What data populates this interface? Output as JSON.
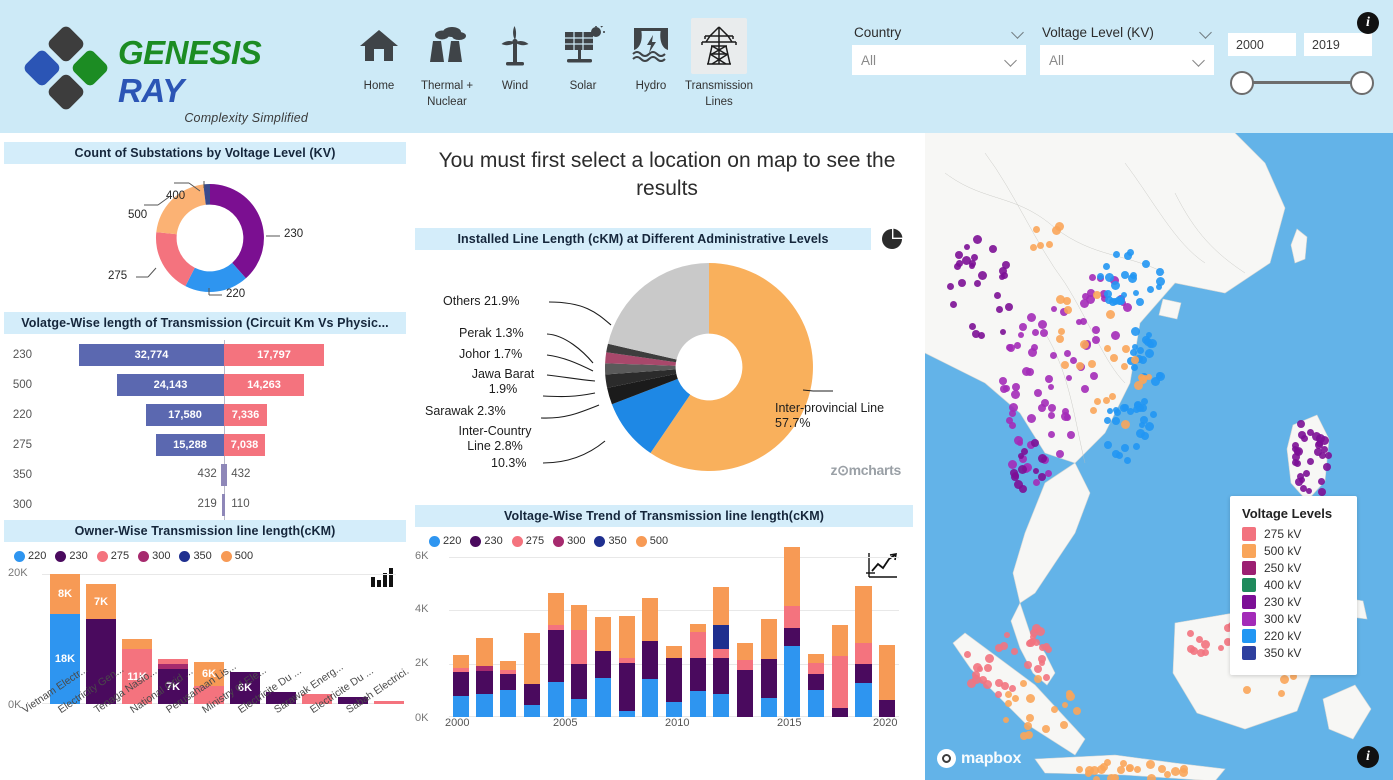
{
  "brand": {
    "name_part1": "GENESIS",
    "name_part2": "RAY",
    "tagline": "Complexity Simplified"
  },
  "nav": {
    "items": [
      {
        "label": "Home",
        "icon": "home-icon",
        "selected": false
      },
      {
        "label": "Thermal + Nuclear",
        "icon": "thermal-nuclear-icon",
        "selected": false
      },
      {
        "label": "Wind",
        "icon": "wind-turbine-icon",
        "selected": false
      },
      {
        "label": "Solar",
        "icon": "solar-panel-icon",
        "selected": false
      },
      {
        "label": "Hydro",
        "icon": "hydro-dam-icon",
        "selected": false
      },
      {
        "label": "Transmission Lines",
        "icon": "transmission-tower-icon",
        "selected": true
      }
    ]
  },
  "filters": {
    "country": {
      "label": "Country",
      "value": "All"
    },
    "voltage": {
      "label": "Voltage Level (KV)",
      "value": "All"
    },
    "year_range": {
      "start": "2000",
      "end": "2019"
    }
  },
  "header_info_icon": "i",
  "center_message": "You must first select a location on map to see the results",
  "panels": {
    "substations": {
      "title": "Count of Substations by Voltage Level (KV)"
    },
    "tornado": {
      "title": "Volatge-Wise length of Transmission (Circuit Km Vs Physic..."
    },
    "owner": {
      "title": "Owner-Wise Transmission line length(cKM)"
    },
    "pie": {
      "title": "Installed Line Length (cKM) at Different Administrative Levels"
    },
    "trend": {
      "title": "Voltage-Wise Trend of Transmission line length(cKM)"
    }
  },
  "watermark": "z⊙mcharts",
  "map": {
    "legend_title": "Voltage Levels",
    "legend": [
      {
        "label": "275 kV",
        "color": "#f2737f"
      },
      {
        "label": "500 kV",
        "color": "#f9a55a"
      },
      {
        "label": "250 kV",
        "color": "#9c1f72"
      },
      {
        "label": "400 kV",
        "color": "#1f8a5c"
      },
      {
        "label": "230 kV",
        "color": "#7c0f96"
      },
      {
        "label": "300 kV",
        "color": "#a32bb8"
      },
      {
        "label": "220 kV",
        "color": "#2196f3"
      },
      {
        "label": "350 kV",
        "color": "#2e3f9e"
      }
    ],
    "attribution": "mapbox",
    "info_icon": "i"
  },
  "chart_data": [
    {
      "type": "pie",
      "name": "substations-donut",
      "title": "Count of Substations by Voltage Level (KV)",
      "labels": [
        "230",
        "220",
        "275",
        "500",
        "400"
      ],
      "values": [
        38.0,
        18.0,
        17.0,
        25.0,
        2.0
      ],
      "colors": [
        "#7b0f91",
        "#2e95f0",
        "#f4737e",
        "#fbb274",
        "#3a4a8c"
      ],
      "donut": true
    },
    {
      "type": "bar",
      "name": "tornado-voltage-length",
      "title": "Volatge-Wise length of Transmission (Circuit Km Vs Physic...",
      "orientation": "horizontal-tornado",
      "categories": [
        "230",
        "500",
        "220",
        "275",
        "350",
        "300"
      ],
      "series": [
        {
          "name": "Circuit Km",
          "color": "#5b68b0",
          "values": [
            32774,
            24143,
            17580,
            15288,
            432,
            219
          ],
          "labels": [
            "32,774",
            "24,143",
            "17,580",
            "15,288",
            "432",
            "219"
          ]
        },
        {
          "name": "Physical Km",
          "color": "#f4737e",
          "values": [
            17797,
            14263,
            7336,
            7038,
            432,
            110
          ],
          "labels": [
            "17,797",
            "14,263",
            "7,336",
            "7,038",
            "432",
            "110"
          ]
        }
      ]
    },
    {
      "type": "bar",
      "name": "owner-wise-length",
      "title": "Owner-Wise Transmission line length(cKM)",
      "stacked": true,
      "ylabel": "",
      "yticks": [
        "0K",
        "20K"
      ],
      "ylim": [
        0,
        26000
      ],
      "legend": [
        {
          "label": "220",
          "color": "#2e95f0"
        },
        {
          "label": "230",
          "color": "#4a0a5e"
        },
        {
          "label": "275",
          "color": "#f4737e"
        },
        {
          "label": "300",
          "color": "#a62a6e"
        },
        {
          "label": "350",
          "color": "#1f2f8f"
        },
        {
          "label": "500",
          "color": "#f79a55"
        }
      ],
      "categories": [
        "Vietnam Electr...",
        "Electricity Gen...",
        "Tenaga Nasio...",
        "National Grid ...",
        "Perusahaan Lis...",
        "Ministry of Ele...",
        "Electricite Du ...",
        "Sarawak Energ...",
        "Electricite Du ...",
        "Sabah Electrici..."
      ],
      "series": [
        {
          "name": "220",
          "color": "#2e95f0",
          "values": [
            18000,
            0,
            0,
            0,
            0,
            0,
            0,
            0,
            0,
            0
          ],
          "datalabels": [
            "18K",
            "",
            "",
            "",
            "",
            "",
            "",
            "",
            "",
            ""
          ]
        },
        {
          "name": "230",
          "color": "#4a0a5e",
          "values": [
            0,
            17000,
            0,
            7000,
            0,
            6000,
            2500,
            0,
            1500,
            0
          ],
          "datalabels": [
            "",
            "",
            "",
            "7K",
            "",
            "6K",
            "",
            "",
            "",
            ""
          ]
        },
        {
          "name": "275",
          "color": "#f4737e",
          "values": [
            0,
            0,
            11000,
            400,
            4000,
            0,
            0,
            2000,
            0,
            400
          ],
          "datalabels": [
            "",
            "",
            "11K",
            "",
            "",
            "",
            "",
            "",
            "",
            ""
          ]
        },
        {
          "name": "300",
          "color": "#a62a6e",
          "values": [
            0,
            0,
            0,
            500,
            0,
            0,
            0,
            0,
            0,
            0
          ],
          "datalabels": [
            "",
            "",
            "",
            "",
            "",
            "",
            "",
            "",
            "",
            ""
          ]
        },
        {
          "name": "500",
          "color": "#f79a55",
          "values": [
            8000,
            7000,
            2000,
            0,
            6000,
            0,
            0,
            0,
            0,
            0
          ],
          "datalabels": [
            "8K",
            "7K",
            "",
            "",
            "6K",
            "",
            "",
            "",
            "",
            ""
          ]
        }
      ]
    },
    {
      "type": "pie",
      "name": "admin-level-pie",
      "title": "Installed Line Length (cKM) at Different Administrative Levels",
      "donut": true,
      "slices": [
        {
          "label": "Inter-provincial Line 57.7%",
          "short": "Inter-provincial Line",
          "value": 57.7,
          "color": "#f9b05c"
        },
        {
          "label": "10.3%",
          "short": "",
          "value": 10.3,
          "color": "#1e88e5"
        },
        {
          "label": "Inter-Country Line 2.8%",
          "short": "Inter-Country Line",
          "value": 2.8,
          "color": "#1b1b1b"
        },
        {
          "label": "Sarawak 2.3%",
          "short": "Sarawak",
          "value": 2.3,
          "color": "#2b2b2b"
        },
        {
          "label": "Jawa Barat 1.9%",
          "short": "Jawa Barat",
          "value": 1.9,
          "color": "#5a5a5a"
        },
        {
          "label": "Johor 1.7%",
          "short": "Johor",
          "value": 1.7,
          "color": "#a8486b"
        },
        {
          "label": "Perak 1.3%",
          "short": "Perak",
          "value": 1.3,
          "color": "#3d3d3d"
        },
        {
          "label": "Others 21.9%",
          "short": "Others",
          "value": 21.9,
          "color": "#c9c9c9"
        }
      ]
    },
    {
      "type": "bar",
      "name": "voltage-trend",
      "title": "Voltage-Wise Trend of Transmission line length(cKM)",
      "stacked": true,
      "yticks": [
        "0K",
        "2K",
        "4K",
        "6K"
      ],
      "ylim": [
        0,
        6000
      ],
      "xticks": [
        "2000",
        "2005",
        "2010",
        "2015",
        "2020"
      ],
      "legend": [
        {
          "label": "220",
          "color": "#2e95f0"
        },
        {
          "label": "230",
          "color": "#4a0a5e"
        },
        {
          "label": "275",
          "color": "#f4737e"
        },
        {
          "label": "300",
          "color": "#a62a6e"
        },
        {
          "label": "350",
          "color": "#1f2f8f"
        },
        {
          "label": "500",
          "color": "#f79a55"
        }
      ],
      "categories": [
        2001,
        2002,
        2003,
        2004,
        2005,
        2006,
        2007,
        2008,
        2009,
        2010,
        2011,
        2012,
        2013,
        2014,
        2015,
        2016,
        2017,
        2018,
        2019
      ],
      "series": [
        {
          "name": "220",
          "color": "#2e95f0",
          "values": [
            800,
            880,
            1020,
            460,
            1320,
            680,
            1460,
            240,
            1420,
            560,
            980,
            860,
            0,
            700,
            2680,
            1000,
            0,
            1280,
            0
          ]
        },
        {
          "name": "230",
          "color": "#4a0a5e",
          "values": [
            900,
            840,
            580,
            760,
            1960,
            1320,
            1020,
            1780,
            1440,
            1660,
            1220,
            1340,
            1780,
            1460,
            640,
            620,
            340,
            720,
            640
          ]
        },
        {
          "name": "275",
          "color": "#f4737e",
          "values": [
            120,
            0,
            160,
            0,
            160,
            1280,
            0,
            200,
            0,
            0,
            1000,
            360,
            340,
            0,
            840,
            420,
            1960,
            760,
            0
          ]
        },
        {
          "name": "300",
          "color": "#a62a6e",
          "values": [
            0,
            180,
            0,
            0,
            0,
            0,
            0,
            0,
            0,
            0,
            0,
            0,
            0,
            0,
            0,
            0,
            0,
            0,
            0
          ]
        },
        {
          "name": "350",
          "color": "#1f2f8f",
          "values": [
            0,
            0,
            0,
            0,
            0,
            0,
            0,
            0,
            0,
            0,
            0,
            900,
            0,
            0,
            0,
            0,
            0,
            0,
            0
          ]
        },
        {
          "name": "500",
          "color": "#f79a55",
          "values": [
            520,
            1080,
            340,
            1940,
            1220,
            940,
            1280,
            1560,
            1620,
            440,
            300,
            1420,
            660,
            1500,
            2200,
            340,
            1160,
            2140,
            2060
          ]
        }
      ]
    }
  ]
}
